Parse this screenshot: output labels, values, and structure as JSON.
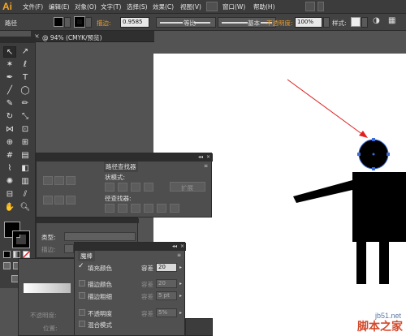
{
  "app": {
    "logo": "Ai"
  },
  "menubar": {
    "items": [
      {
        "label": "文件(F)",
        "name": "menu-file"
      },
      {
        "label": "编辑(E)",
        "name": "menu-edit"
      },
      {
        "label": "对象(O)",
        "name": "menu-object"
      },
      {
        "label": "文字(T)",
        "name": "menu-type"
      },
      {
        "label": "选择(S)",
        "name": "menu-select"
      },
      {
        "label": "效果(C)",
        "name": "menu-effect"
      },
      {
        "label": "视图(V)",
        "name": "menu-view"
      },
      {
        "label": "窗口(W)",
        "name": "menu-window"
      },
      {
        "label": "帮助(H)",
        "name": "menu-help"
      }
    ]
  },
  "control_bar": {
    "selection_label": "路径",
    "stroke_label": "描边:",
    "stroke_weight": "0.9585",
    "profile_label": "等比",
    "brush_label": "基本",
    "opacity_label": "不透明度:",
    "opacity_value": "100%",
    "style_label": "样式:"
  },
  "document": {
    "tab_title": "@ 94% (CMYK/预览)"
  },
  "pathfinder_panel": {
    "title": "路径查找器",
    "shape_modes_label": "状模式:",
    "pathfinders_label": "径查找器:",
    "expand_label": "扩展"
  },
  "stroke_panel": {
    "type_label": "类型:",
    "stroke_label": "描边:"
  },
  "transparency_panel": {
    "opacity_label": "不透明度:",
    "position_label": "位置:"
  },
  "wand_panel": {
    "title": "魔棒",
    "rows": [
      {
        "label": "填充颜色",
        "checked": true,
        "tol_label": "容差",
        "value": "20",
        "enabled": true
      },
      {
        "label": "描边颜色",
        "checked": false,
        "tol_label": "容差",
        "value": "20",
        "enabled": false
      },
      {
        "label": "描边粗细",
        "checked": false,
        "tol_label": "容差",
        "value": "5 pt",
        "enabled": false
      },
      {
        "label": "不透明度",
        "checked": false,
        "tol_label": "容差",
        "value": "5%",
        "enabled": false
      },
      {
        "label": "混合模式",
        "checked": false,
        "tol_label": "",
        "value": "",
        "enabled": false
      }
    ]
  },
  "artwork": {
    "figure_color": "#000000",
    "arrow_color": "#e02020",
    "selection_color": "#3a6bd8"
  },
  "watermark": {
    "site": "jb51.net",
    "name": "脚本之家"
  }
}
